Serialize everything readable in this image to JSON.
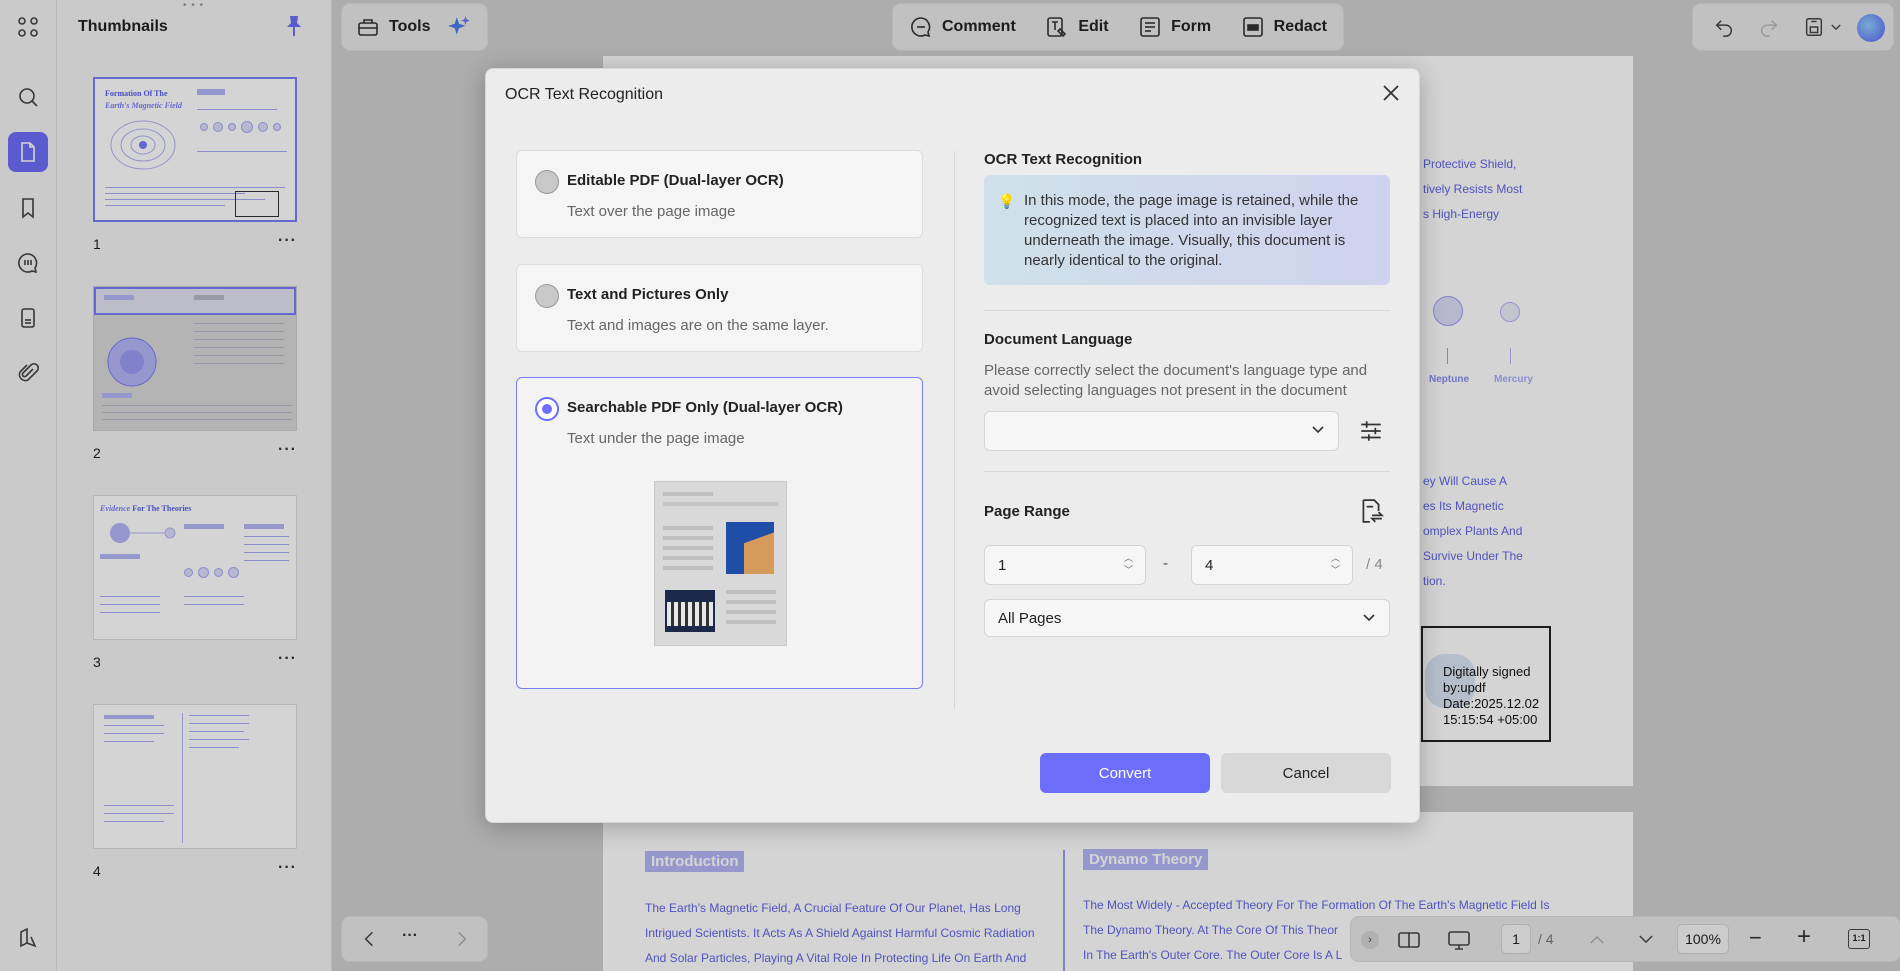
{
  "sidebar": {
    "title": "Thumbnails"
  },
  "thumbnails": [
    {
      "number": "1",
      "title_line1": "Formation Of The",
      "title_line2": "Earth's Magnetic Field",
      "more": "···"
    },
    {
      "number": "2",
      "more": "···"
    },
    {
      "number": "3",
      "title_a": "Evidence",
      "title_b": "For The Theories",
      "more": "···"
    },
    {
      "number": "4",
      "more": "···"
    }
  ],
  "toolbar": {
    "tools": "Tools",
    "comment": "Comment",
    "edit": "Edit",
    "form": "Form",
    "redact": "Redact"
  },
  "document": {
    "right_lines": [
      "Protective Shield,",
      "tively Resists Most",
      "s High-Energy"
    ],
    "planets": [
      "Neptune",
      "Mercury"
    ],
    "mid_lines": [
      "ey Will Cause A",
      "es Its Magnetic",
      "omplex Plants And",
      "Survive Under The",
      "tion."
    ],
    "signature": {
      "line1": "Digitally signed",
      "line2": "by:updf",
      "line3": "Date:2025.12.02",
      "line4": "15:15:54 +05:00"
    },
    "intro_heading": "Introduction",
    "intro_lines": [
      "The Earth's Magnetic Field, A Crucial Feature Of Our Planet, Has Long",
      "Intrigued Scientists. It Acts As A Shield Against Harmful Cosmic Radiation",
      "And Solar Particles, Playing A Vital Role In Protecting Life On Earth And"
    ],
    "dynamo_heading": "Dynamo Theory",
    "dynamo_lines": [
      "The Most Widely - Accepted Theory For The Formation Of The Earth's Magnetic Field Is",
      "The Dynamo Theory. At The Core Of This Theor",
      "In The Earth's Outer Core. The Outer Core Is A L"
    ]
  },
  "dialog": {
    "title": "OCR Text Recognition",
    "options": [
      {
        "title": "Editable PDF (Dual-layer OCR)",
        "desc": "Text over the page image"
      },
      {
        "title": "Text and Pictures Only",
        "desc": "Text and images are on the same layer."
      },
      {
        "title": "Searchable PDF Only (Dual-layer OCR)",
        "desc": "Text under the page image"
      }
    ],
    "selected_option": 3,
    "info_title": "OCR Text Recognition",
    "info_text": "In this mode, the page image is retained, while the recognized text is placed into an invisible layer underneath the image. Visually, this document is nearly identical to the original.",
    "language_title": "Document Language",
    "language_help": "Please correctly select the document's language type and avoid selecting languages not present in the document",
    "language_value": "",
    "range_title": "Page Range",
    "range_from": "1",
    "range_sep": "-",
    "range_to": "4",
    "range_total": "/ 4",
    "pages_select": "All Pages",
    "convert": "Convert",
    "cancel": "Cancel"
  },
  "bottom": {
    "more": "···",
    "page_current": "1",
    "page_total": "/ 4",
    "zoom": "100%"
  },
  "colors": {
    "accent": "#6b6ef9",
    "doc_text": "#6164e6"
  }
}
